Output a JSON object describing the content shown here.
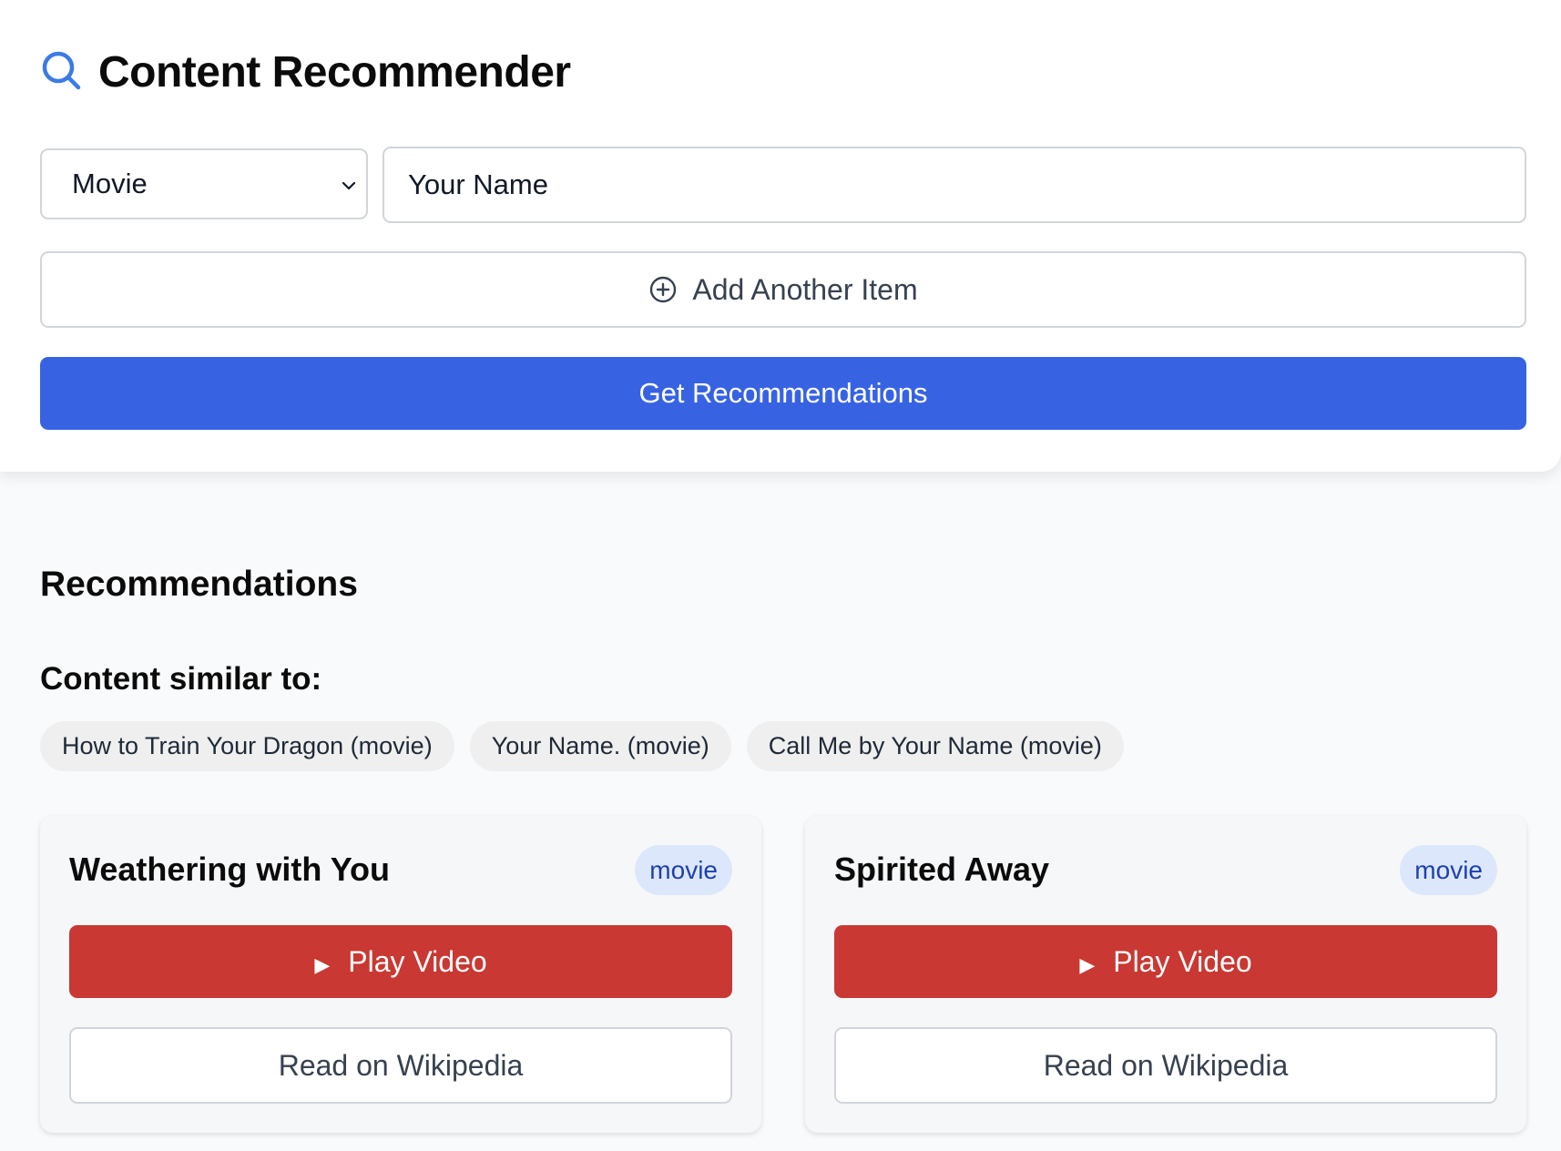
{
  "app": {
    "title": "Content Recommender",
    "icon": "search-icon",
    "accent_color": "#3763e3"
  },
  "form": {
    "type_select": {
      "value": "Movie",
      "icon": "chevron-down-icon"
    },
    "item_input": {
      "value": "Your Name"
    },
    "add_item_label": "Add Another Item",
    "add_item_icon": "plus-circle-icon",
    "submit_label": "Get Recommendations"
  },
  "results": {
    "heading": "Recommendations",
    "similar_heading": "Content similar to:",
    "similar_items": [
      "How to Train Your Dragon (movie)",
      "Your Name. (movie)",
      "Call Me by Your Name (movie)"
    ],
    "cards": [
      {
        "title": "Weathering with You",
        "badge": "movie",
        "play_label": "Play Video",
        "wiki_label": "Read on Wikipedia"
      },
      {
        "title": "Spirited Away",
        "badge": "movie",
        "play_label": "Play Video",
        "wiki_label": "Read on Wikipedia"
      }
    ],
    "play_color": "#c93832",
    "badge_color": "#dde7fb"
  }
}
